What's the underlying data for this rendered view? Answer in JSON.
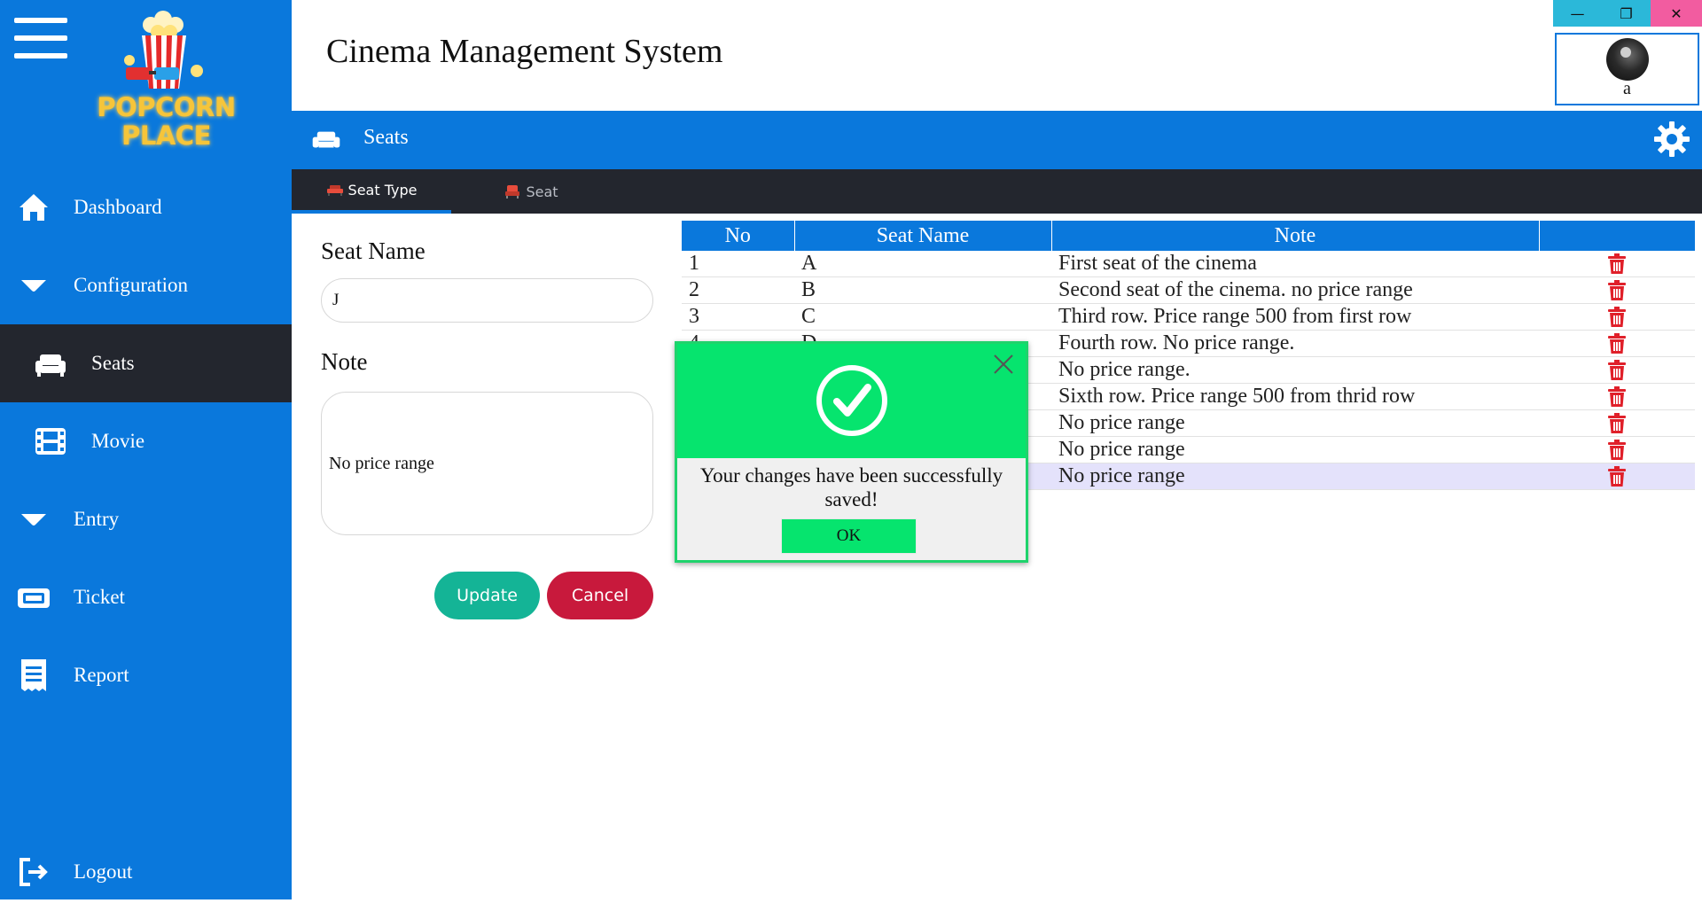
{
  "window": {
    "title": "Cinema Management System",
    "minimize": "—",
    "restore": "❐",
    "close": "✕"
  },
  "logo": {
    "line1": "POPCORN",
    "line2": "PLACE"
  },
  "sidebar": {
    "items": [
      {
        "label": "Dashboard",
        "icon": "home-icon"
      },
      {
        "label": "Configuration",
        "icon": "caret-down-icon"
      },
      {
        "label": "Seats",
        "icon": "sofa-icon",
        "active": true
      },
      {
        "label": "Movie",
        "icon": "film-icon"
      },
      {
        "label": "Entry",
        "icon": "caret-down-icon"
      },
      {
        "label": "Ticket",
        "icon": "ticket-icon"
      },
      {
        "label": "Report",
        "icon": "receipt-icon"
      }
    ],
    "logout": "Logout"
  },
  "user": {
    "name": "a"
  },
  "section": {
    "title": "Seats"
  },
  "tabs": [
    {
      "label": "Seat Type",
      "active": true
    },
    {
      "label": "Seat",
      "active": false
    }
  ],
  "form": {
    "seat_name_label": "Seat Name",
    "seat_name_value": "J",
    "note_label": "Note",
    "note_value": "No price range",
    "update_label": "Update",
    "cancel_label": "Cancel"
  },
  "table": {
    "headers": [
      "No",
      "Seat Name",
      "Note",
      ""
    ],
    "rows": [
      {
        "no": "1",
        "name": "A",
        "note": "First seat of the cinema"
      },
      {
        "no": "2",
        "name": "B",
        "note": "Second seat of the cinema. no price range"
      },
      {
        "no": "3",
        "name": "C",
        "note": "Third row. Price range 500 from first row"
      },
      {
        "no": "4",
        "name": "D",
        "note": "Fourth row. No price range."
      },
      {
        "no": "",
        "name": "",
        "note": "No price range."
      },
      {
        "no": "",
        "name": "",
        "note": "Sixth row. Price range 500 from thrid row"
      },
      {
        "no": "",
        "name": "",
        "note": "No price range"
      },
      {
        "no": "",
        "name": "",
        "note": "No price range"
      },
      {
        "no": "",
        "name": "",
        "note": "No price range",
        "selected": true
      }
    ]
  },
  "dialog": {
    "message": "Your changes have been successfully saved!",
    "ok_label": "OK"
  },
  "colors": {
    "primary": "#0a78dc",
    "dark": "#23262e",
    "success": "#06e46e",
    "update": "#14b496",
    "cancel": "#c8193c",
    "delete": "#e0202a"
  }
}
